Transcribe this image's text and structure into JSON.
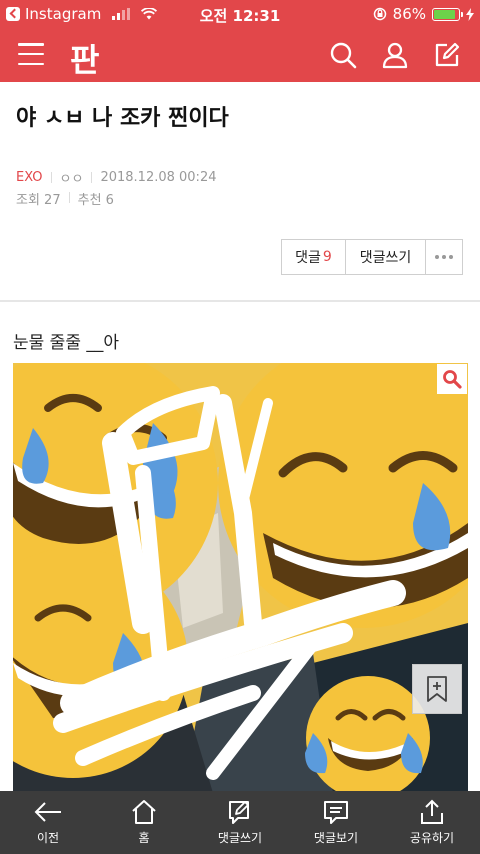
{
  "status_bar": {
    "back_app": "Instagram",
    "time": "오전 12:31",
    "battery": "86%",
    "battery_level": 0.86
  },
  "app_bar": {
    "logo": "판",
    "icons": [
      "menu-icon",
      "search-icon",
      "user-icon",
      "edit-icon"
    ]
  },
  "article": {
    "title": "야 ㅅㅂ 나 조카 찐이다",
    "category": "EXO",
    "author": "ㅇㅇ",
    "datetime": "2018.12.08 00:24",
    "views": "조회 27",
    "recommends": "추천 6",
    "body": "눈물 줄줄 __아"
  },
  "actions": {
    "comments_label": "댓글",
    "comments_count": "9",
    "write_label": "댓글쓰기"
  },
  "bottom_nav": [
    {
      "label": "이전",
      "icon": "arrow-left-icon"
    },
    {
      "label": "홈",
      "icon": "home-icon"
    },
    {
      "label": "댓글쓰기",
      "icon": "write-comment-icon"
    },
    {
      "label": "댓글보기",
      "icon": "view-comments-icon"
    },
    {
      "label": "공유하기",
      "icon": "share-icon"
    }
  ],
  "colors": {
    "brand": "#e2474a",
    "bottom_bar": "#3c3c3c"
  }
}
